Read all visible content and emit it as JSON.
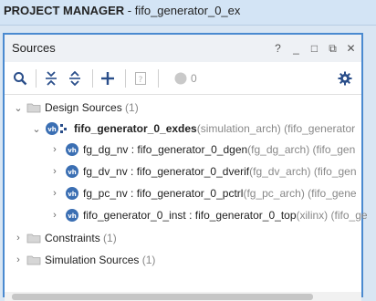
{
  "title_bar": {
    "label": "PROJECT MANAGER",
    "project": " - fifo_generator_0_ex"
  },
  "panel": {
    "title": "Sources",
    "controls": [
      "?",
      "_",
      "□",
      "⧉",
      "✕"
    ],
    "toolbar": {
      "search_icon": "search-icon",
      "collapse_all_icon": "collapse-all-icon",
      "expand_all_icon": "expand-all-icon",
      "add_icon": "plus-icon",
      "properties_icon": "question-doc-icon",
      "status_count": "0",
      "settings_icon": "gear-icon"
    }
  },
  "tree": {
    "design_sources": {
      "label": "Design Sources",
      "count": " (1)"
    },
    "top": {
      "name": "fifo_generator_0_exdes",
      "arch": "(simulation_arch)",
      "extra": " (fifo_generator"
    },
    "children": [
      {
        "inst": "fg_dg_nv",
        "mod": " : fifo_generator_0_dgen",
        "arch": "(fg_dg_arch)",
        "extra": " (fifo_gen"
      },
      {
        "inst": "fg_dv_nv",
        "mod": " : fifo_generator_0_dverif",
        "arch": "(fg_dv_arch)",
        "extra": " (fifo_gen"
      },
      {
        "inst": "fg_pc_nv",
        "mod": " : fifo_generator_0_pctrl",
        "arch": "(fg_pc_arch)",
        "extra": " (fifo_gene"
      },
      {
        "inst": "fifo_generator_0_inst",
        "mod": " : fifo_generator_0_top",
        "arch": "(xilinx)",
        "extra": " (fifo_ge"
      }
    ],
    "constraints": {
      "label": "Constraints",
      "count": " (1)"
    },
    "simulation_sources": {
      "label": "Simulation Sources",
      "count": " (1)"
    }
  },
  "colors": {
    "accent": "#4a8ad0",
    "vh_icon": "#3b6fb3",
    "folder": "#c9c9c9"
  }
}
